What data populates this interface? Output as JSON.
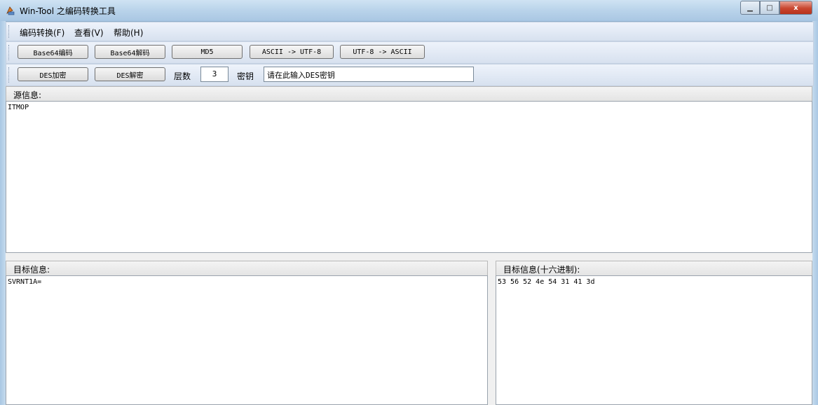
{
  "window": {
    "title": "Win-Tool 之编码转换工具",
    "close_glyph": "x",
    "min_glyph": "▁",
    "max_glyph": "□"
  },
  "menu": {
    "items": [
      "编码转换(F)",
      "查看(V)",
      "帮助(H)"
    ]
  },
  "toolbar1": {
    "buttons": [
      "Base64编码",
      "Base64解码",
      "MD5",
      "ASCII -> UTF-8",
      "UTF-8 -> ASCII"
    ]
  },
  "toolbar2": {
    "des_encrypt": "DES加密",
    "des_decrypt": "DES解密",
    "layers_label": "层数",
    "layers_value": "3",
    "key_label": "密钥",
    "key_placeholder": "请在此输入DES密钥"
  },
  "source": {
    "header": "源信息:",
    "content": "ITMOP"
  },
  "target": {
    "header": "目标信息:",
    "content": "SVRNT1A="
  },
  "target_hex": {
    "header": "目标信息(十六进制):",
    "content": "53 56 52 4e 54 31 41 3d"
  }
}
